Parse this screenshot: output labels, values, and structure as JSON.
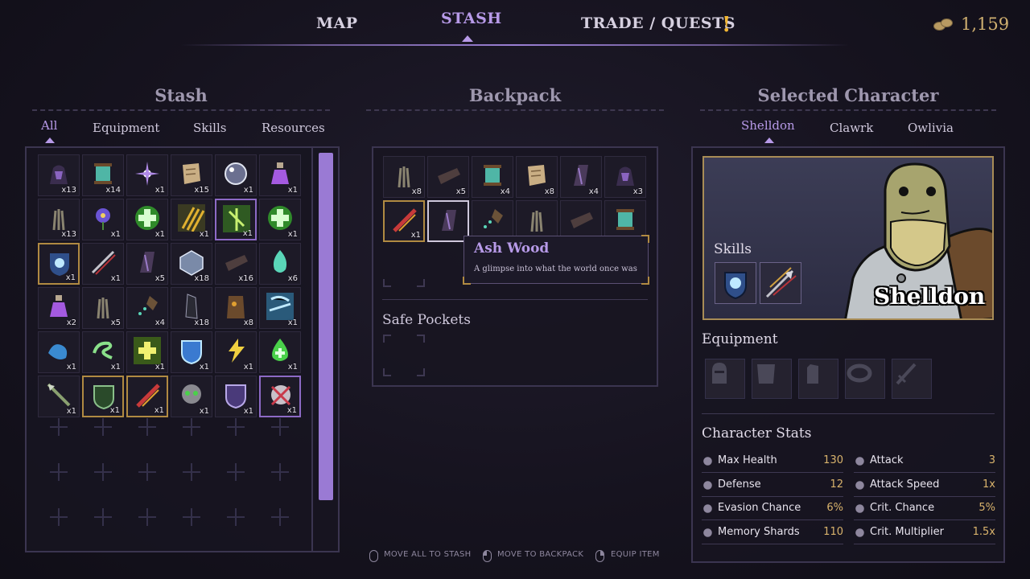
{
  "nav": {
    "tabs": [
      {
        "label": "MAP"
      },
      {
        "label": "STASH",
        "active": true
      },
      {
        "label": "TRADE / QUESTS",
        "alert": "!"
      }
    ],
    "currency": "1,159"
  },
  "stash": {
    "title": "Stash",
    "tabs": [
      "All",
      "Equipment",
      "Skills",
      "Resources"
    ],
    "active_tab": "All",
    "items": [
      {
        "icon": "hood-icon",
        "qty": "x13"
      },
      {
        "icon": "thread-spool-icon",
        "qty": "x14"
      },
      {
        "icon": "sparkle-burst-icon",
        "qty": "x1"
      },
      {
        "icon": "parchment-icon",
        "qty": "x15"
      },
      {
        "icon": "glass-orb-icon",
        "qty": "x1"
      },
      {
        "icon": "purple-potion-icon",
        "qty": "x1"
      },
      {
        "icon": "wheat-icon",
        "qty": "x13"
      },
      {
        "icon": "purple-flower-icon",
        "qty": "x1"
      },
      {
        "icon": "heal-cross-icon",
        "qty": "x1"
      },
      {
        "icon": "claw-slash-icon",
        "qty": "x1"
      },
      {
        "icon": "green-totem-icon",
        "qty": "x1"
      },
      {
        "icon": "heal-cross-icon",
        "qty": "x1"
      },
      {
        "icon": "shield-bash-icon",
        "qty": "x1"
      },
      {
        "icon": "arrow-volley-icon",
        "qty": "x1"
      },
      {
        "icon": "ash-wood-icon",
        "qty": "x5"
      },
      {
        "icon": "crystal-cube-icon",
        "qty": "x18"
      },
      {
        "icon": "leather-icon",
        "qty": "x16"
      },
      {
        "icon": "green-flame-icon",
        "qty": "x6"
      },
      {
        "icon": "purple-potion-icon",
        "qty": "x2"
      },
      {
        "icon": "wheat-icon",
        "qty": "x5"
      },
      {
        "icon": "seed-trail-icon",
        "qty": "x4"
      },
      {
        "icon": "dark-shard-icon",
        "qty": "x18"
      },
      {
        "icon": "wood-log-icon",
        "qty": "x8"
      },
      {
        "icon": "storm-icon",
        "qty": "x1"
      },
      {
        "icon": "water-wave-icon",
        "qty": "x1"
      },
      {
        "icon": "wind-swirl-icon",
        "qty": "x1"
      },
      {
        "icon": "lightning-heal-icon",
        "qty": "x1"
      },
      {
        "icon": "water-shield-icon",
        "qty": "x1"
      },
      {
        "icon": "lightning-strike-icon",
        "qty": "x1"
      },
      {
        "icon": "green-drop-icon",
        "qty": "x1"
      },
      {
        "icon": "spear-icon",
        "qty": "x1"
      },
      {
        "icon": "leaf-shield-icon",
        "qty": "x1"
      },
      {
        "icon": "red-slash-icon",
        "qty": "x1"
      },
      {
        "icon": "poison-skull-icon",
        "qty": "x1"
      },
      {
        "icon": "purple-shield-icon",
        "qty": "x1"
      },
      {
        "icon": "cursed-skull-icon",
        "qty": "x1"
      }
    ]
  },
  "backpack": {
    "title": "Backpack",
    "items": [
      {
        "icon": "wheat-icon",
        "qty": "x8"
      },
      {
        "icon": "leather-icon",
        "qty": "x5"
      },
      {
        "icon": "thread-spool-icon",
        "qty": "x4"
      },
      {
        "icon": "parchment-icon",
        "qty": "x8"
      },
      {
        "icon": "ash-wood-icon",
        "qty": "x4"
      },
      {
        "icon": "hood-icon",
        "qty": "x3"
      },
      {
        "icon": "red-slash-icon",
        "qty": "x1"
      },
      {
        "icon": "ash-wood-icon",
        "qty": ""
      },
      {
        "icon": "seed-trail-icon",
        "qty": ""
      },
      {
        "icon": "wheat-icon",
        "qty": ""
      },
      {
        "icon": "leather-icon",
        "qty": ""
      },
      {
        "icon": "thread-spool-icon",
        "qty": ""
      }
    ],
    "tooltip": {
      "title": "Ash Wood",
      "description": "A glimpse into what the world once was"
    },
    "safe_pockets_label": "Safe Pockets"
  },
  "character": {
    "title": "Selected Character",
    "tabs": [
      "Shelldon",
      "Clawrk",
      "Owlivia"
    ],
    "active_tab": "Shelldon",
    "name": "Shelldon",
    "skills_label": "Skills",
    "skills": [
      {
        "icon": "shield-bash-icon"
      },
      {
        "icon": "arrow-volley-icon"
      }
    ],
    "equipment_label": "Equipment",
    "equipment_slots": [
      {
        "icon": "helmet-icon"
      },
      {
        "icon": "chest-armor-icon"
      },
      {
        "icon": "gauntlet-icon"
      },
      {
        "icon": "ring-icon"
      },
      {
        "icon": "sword-icon"
      }
    ],
    "stats_label": "Character Stats",
    "stats": [
      {
        "name": "Max Health",
        "value": "130",
        "icon": "heart-icon"
      },
      {
        "name": "Attack",
        "value": "3",
        "icon": "sword-icon"
      },
      {
        "name": "Defense",
        "value": "12",
        "icon": "shield-icon"
      },
      {
        "name": "Attack Speed",
        "value": "1x",
        "icon": "double-sword-icon"
      },
      {
        "name": "Evasion Chance",
        "value": "6%",
        "icon": "dodge-icon"
      },
      {
        "name": "Crit. Chance",
        "value": "5%",
        "icon": "crit-sword-icon"
      },
      {
        "name": "Memory Shards",
        "value": "110",
        "icon": "eye-icon"
      },
      {
        "name": "Crit. Multiplier",
        "value": "1.5x",
        "icon": "crit-multiplier-icon"
      }
    ]
  },
  "hints": [
    {
      "label": "MOVE ALL TO STASH",
      "mouse": "middle"
    },
    {
      "label": "MOVE TO BACKPACK",
      "mouse": "left"
    },
    {
      "label": "EQUIP ITEM",
      "mouse": "right"
    }
  ],
  "colors": {
    "accent": "#b79ae8",
    "gold": "#d9b36c",
    "scrollbar": "#9a7ad4"
  }
}
